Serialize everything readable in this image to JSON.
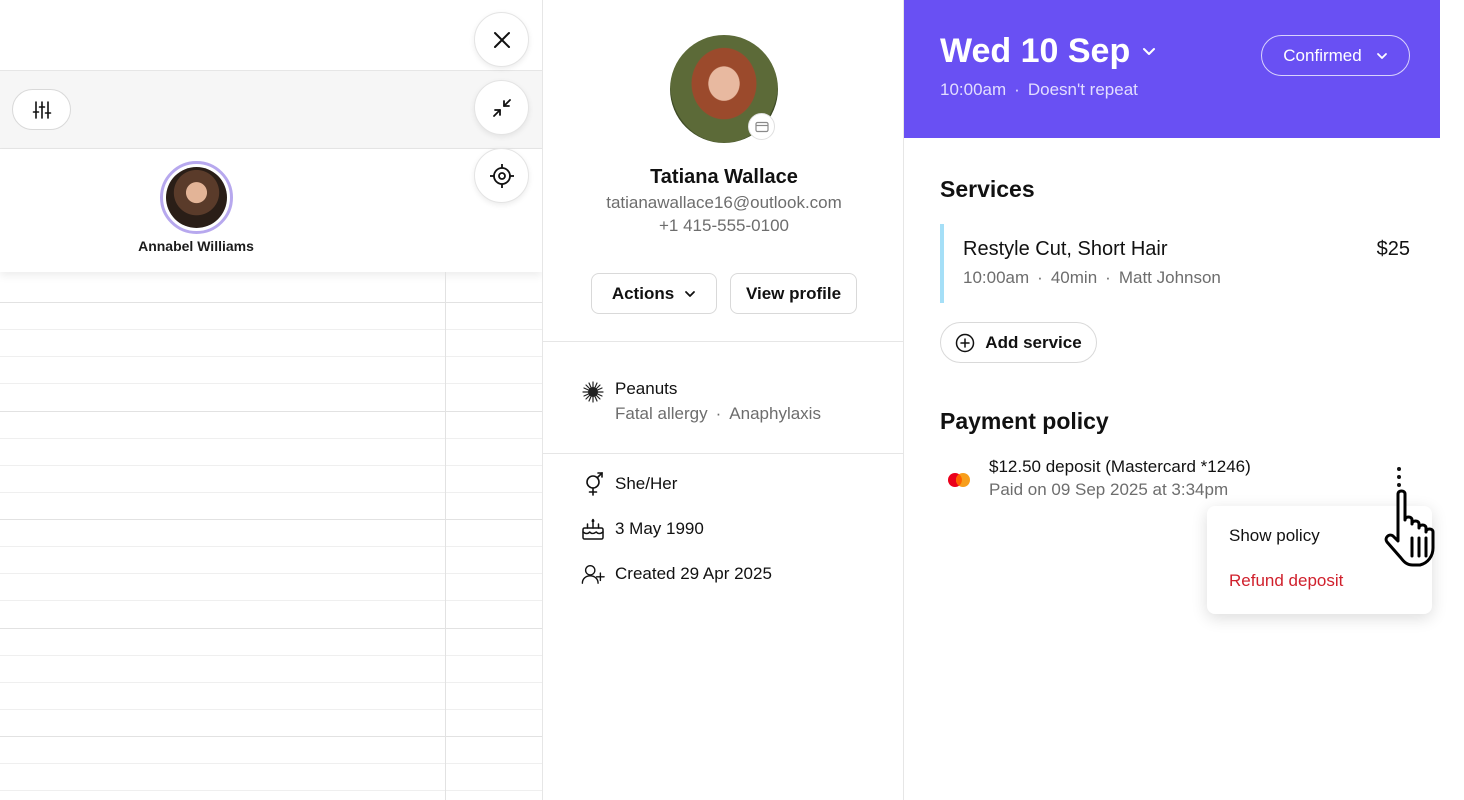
{
  "calendar": {
    "staff_name": "Annabel Williams"
  },
  "client": {
    "name": "Tatiana Wallace",
    "email": "tatianawallace16@outlook.com",
    "phone": "+1 415-555-0100",
    "actions_label": "Actions",
    "view_profile_label": "View profile",
    "allergy": {
      "title": "Peanuts",
      "severity": "Fatal allergy",
      "reaction": "Anaphylaxis"
    },
    "pronouns": "She/Her",
    "birthday": "3 May 1990",
    "created": "Created 29 Apr 2025"
  },
  "appointment": {
    "date": "Wed 10 Sep",
    "time": "10:00am",
    "repeat": "Doesn't repeat",
    "status": "Confirmed",
    "accent_color": "#6950f3",
    "services_title": "Services",
    "service": {
      "name": "Restyle Cut, Short Hair",
      "price": "$25",
      "time": "10:00am",
      "duration": "40min",
      "staff": "Matt Johnson",
      "color": "#a5dff7"
    },
    "add_service_label": "Add service",
    "payment_policy_title": "Payment policy",
    "payment": {
      "line1": "$12.50 deposit (Mastercard *1246)",
      "line2": "Paid on 09 Sep 2025 at 3:34pm"
    },
    "menu": {
      "show_policy": "Show policy",
      "refund_deposit": "Refund deposit",
      "refund_color": "#d0202c"
    }
  },
  "icons": [
    "close-icon",
    "collapse-icon",
    "locate-icon",
    "filter-icon",
    "card-icon",
    "chevron-down-icon",
    "allergy-icon",
    "gender-icon",
    "cake-icon",
    "user-add-icon",
    "add-circle-icon",
    "mastercard-icon",
    "more-vertical-icon",
    "hand-pointer-icon"
  ]
}
